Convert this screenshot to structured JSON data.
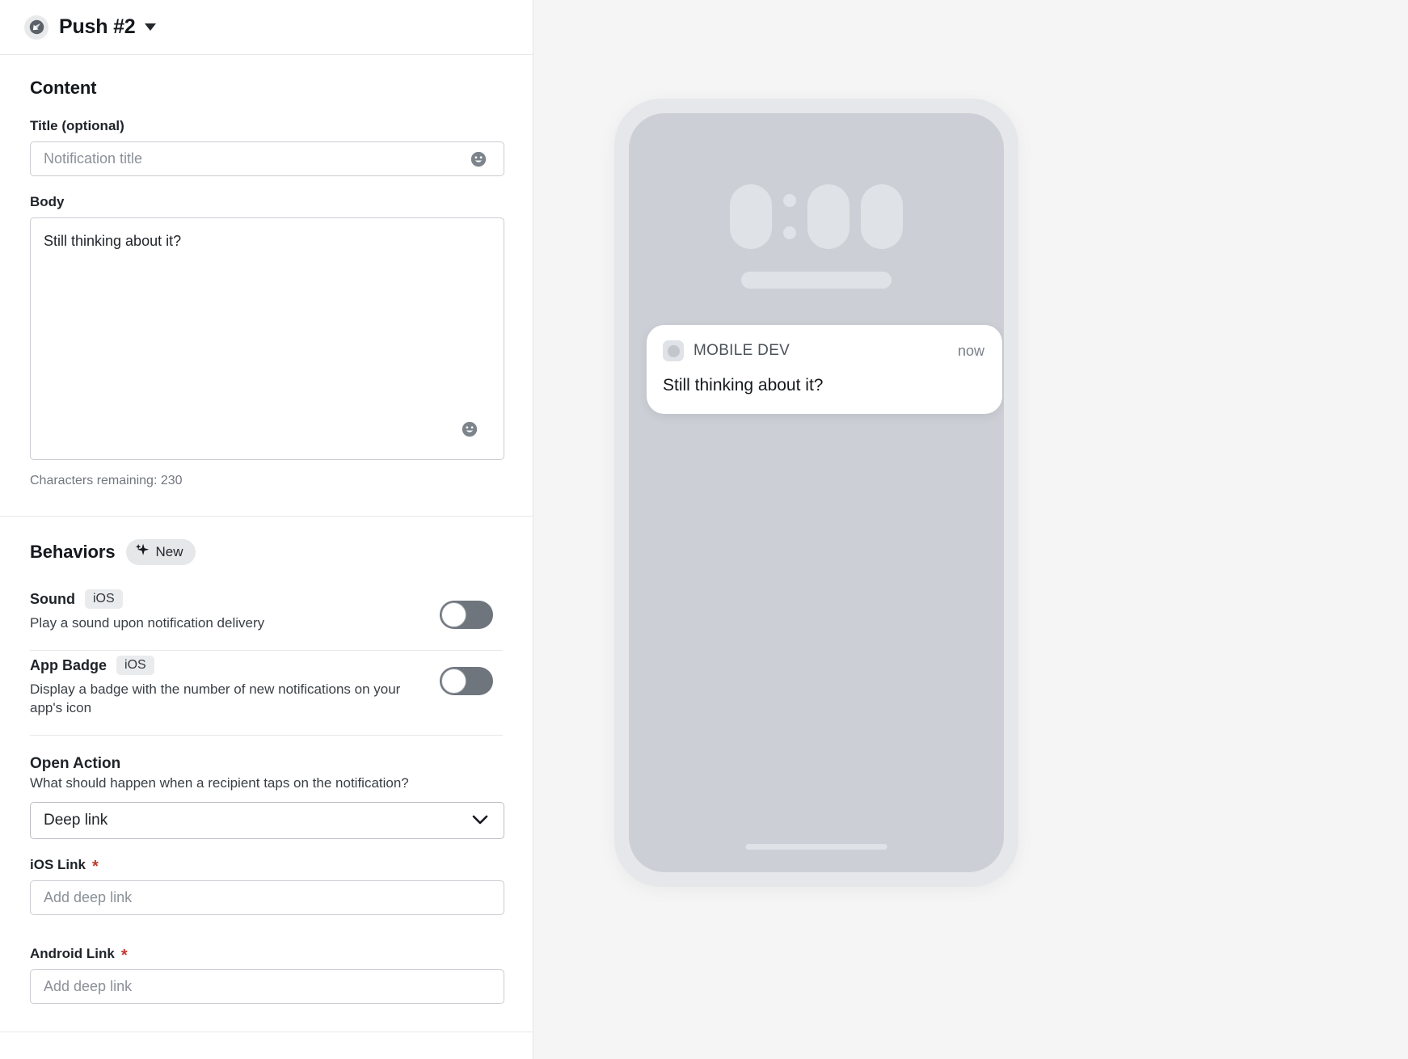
{
  "header": {
    "icon": "push-send-icon",
    "title": "Push #2",
    "caret": "chevron-down-icon"
  },
  "content_section": {
    "heading": "Content",
    "title_field": {
      "label": "Title (optional)",
      "placeholder": "Notification title",
      "value": "",
      "emoji_icon": "emoji-smiley-icon"
    },
    "body_field": {
      "label": "Body",
      "value": "Still thinking about it?",
      "placeholder": "",
      "emoji_icon": "emoji-smiley-icon"
    },
    "characters_remaining": "Characters remaining: 230"
  },
  "behaviors_section": {
    "heading": "Behaviors",
    "badge": {
      "icon": "sparkles-icon",
      "label": "New"
    },
    "rows": [
      {
        "title": "Sound",
        "platform": "iOS",
        "description": "Play a sound upon notification delivery",
        "toggle_state": "off"
      },
      {
        "title": "App Badge",
        "platform": "iOS",
        "description": "Display a badge with the number of new notifications on your app's icon",
        "toggle_state": "off"
      }
    ],
    "open_action": {
      "title": "Open Action",
      "subtitle": "What should happen when a recipient taps on the notification?",
      "selected": "Deep link",
      "options": [
        "Deep link"
      ],
      "chevron_icon": "chevron-down-icon"
    },
    "ios_link": {
      "label": "iOS Link",
      "required_marker": "*",
      "placeholder": "Add deep link",
      "value": ""
    },
    "android_link": {
      "label": "Android Link",
      "required_marker": "*",
      "placeholder": "Add deep link",
      "value": ""
    }
  },
  "preview": {
    "notification": {
      "app_name": "MOBILE DEV",
      "time": "now",
      "body": "Still thinking about it?",
      "app_icon": "app-placeholder-icon"
    }
  },
  "colors": {
    "accent_required": "#c0392b",
    "panel_bg": "#ffffff",
    "preview_bg": "#f5f5f5",
    "phone_screen": "#ccd0d6",
    "toggle_off_track": "#6f757d"
  }
}
